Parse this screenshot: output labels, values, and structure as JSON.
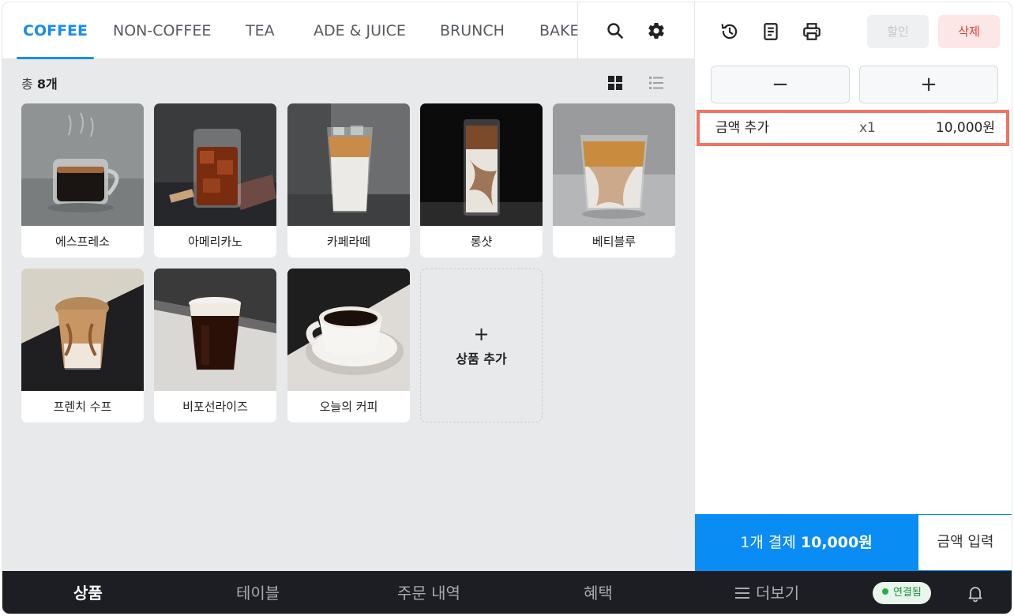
{
  "categories": [
    {
      "label": "COFFEE",
      "active": true
    },
    {
      "label": "NON-COFFEE",
      "active": false
    },
    {
      "label": "TEA",
      "active": false
    },
    {
      "label": "ADE & JUICE",
      "active": false
    },
    {
      "label": "BRUNCH",
      "active": false
    },
    {
      "label": "BAKE",
      "active": false
    }
  ],
  "toolbar_icons": [
    "search-icon",
    "gear-icon",
    "grid-view-icon",
    "list-view-icon"
  ],
  "summary": {
    "prefix": "총",
    "count": "8개"
  },
  "products": [
    {
      "name": "에스프레소"
    },
    {
      "name": "아메리카노"
    },
    {
      "name": "카페라떼"
    },
    {
      "name": "롱샷"
    },
    {
      "name": "베티블루"
    },
    {
      "name": "프렌치 수프"
    },
    {
      "name": "비포선라이즈"
    },
    {
      "name": "오늘의 커피"
    }
  ],
  "add_product": {
    "plus": "+",
    "label": "상품 추가"
  },
  "order_panel": {
    "icons": [
      "history-icon",
      "receipt-icon",
      "printer-icon"
    ],
    "discount_label": "할인",
    "delete_label": "삭제",
    "minus_label": "−",
    "plus_label": "+",
    "items": [
      {
        "name": "금액 추가",
        "qty": "x1",
        "price": "10,000원"
      }
    ],
    "pay_count": "1개 결제",
    "pay_amount": "10,000원",
    "amount_input_label": "금액 입력"
  },
  "bottom_nav": {
    "items": [
      {
        "label": "상품",
        "active": true
      },
      {
        "label": "테이블",
        "active": false
      },
      {
        "label": "주문 내역",
        "active": false
      },
      {
        "label": "혜택",
        "active": false
      },
      {
        "label": "더보기",
        "active": false
      }
    ],
    "status": "연결됨",
    "bell_icon": "bell-icon"
  },
  "colors": {
    "accent": "#1a8cf0",
    "pay_button": "#0a8cf5",
    "delete": "#e03b3b",
    "highlight_border": "#f07464",
    "bottom_bar": "#1c1e24"
  }
}
